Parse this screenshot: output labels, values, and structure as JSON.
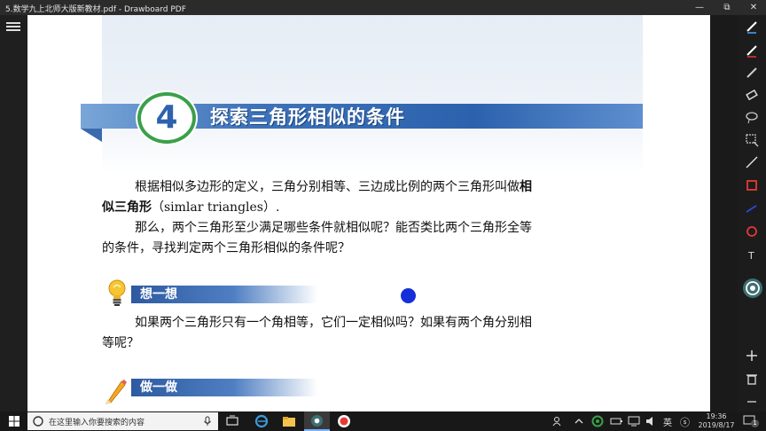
{
  "window": {
    "title": "5.数学九上北师大版新教材.pdf - Drawboard PDF",
    "controls": {
      "minimize": "—",
      "restore": "⧉",
      "close": "✕"
    }
  },
  "document": {
    "chapter_number": "4",
    "chapter_title": "探索三角形相似的条件",
    "paragraphs": {
      "p1_line1_a": "根据相似多边形的定义，三角分别相等、三边成比例的两个三角形叫做",
      "p1_line1_b": "相",
      "p1_line2_a": "似三角形",
      "p1_line2_b": "（simlar triangles）.",
      "p2_line1": "那么，两个三角形至少满足哪些条件就相似呢？能否类比两个三角形全等",
      "p2_line2": "的条件，寻找判定两个三角形相似的条件呢？",
      "think_line1": "如果两个三角形只有一个角相等，它们一定相似吗？如果有两个角分别相",
      "think_line2": "等呢？"
    },
    "sections": {
      "think": "想一想",
      "do": "做一做"
    }
  },
  "taskbar": {
    "search_placeholder": "在这里输入你要搜索的内容",
    "ime": "英",
    "time": "19:36",
    "date": "2019/8/17",
    "notification_count": "1"
  },
  "colors": {
    "band_blue": "#2c62ad",
    "circle_green": "#3aa04a",
    "cursor_blue": "#1530d8"
  }
}
